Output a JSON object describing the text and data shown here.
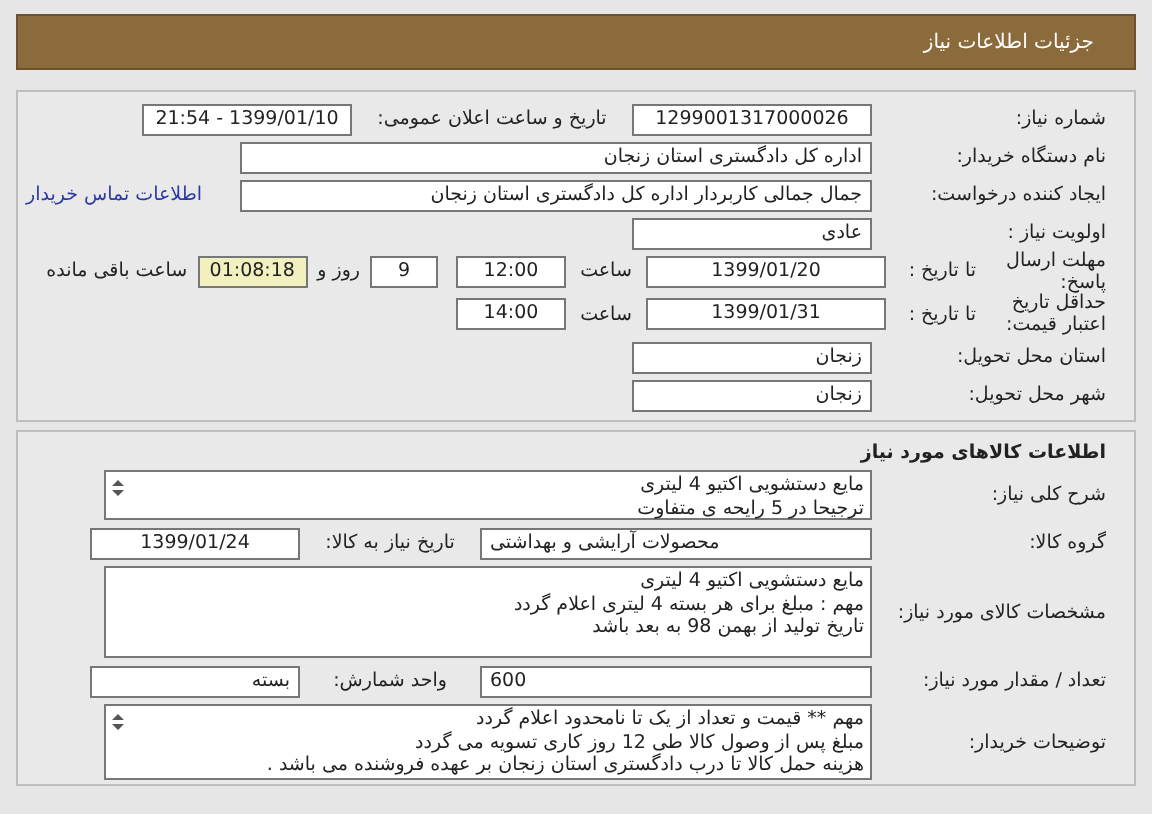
{
  "header": {
    "title": "جزئیات اطلاعات نیاز"
  },
  "details": {
    "need_number": {
      "label": "شماره نیاز:",
      "value": "1299001317000026"
    },
    "announce": {
      "label": "تاریخ و ساعت اعلان عمومی:",
      "value": "1399/01/10 - 21:54"
    },
    "buyer_org": {
      "label": "نام دستگاه خریدار:",
      "value": "اداره کل دادگستری استان زنجان"
    },
    "requester": {
      "label": "ایجاد کننده درخواست:",
      "value": "جمال جمالی کاربردار اداره کل دادگستری استان زنجان",
      "link": "اطلاعات تماس خریدار"
    },
    "priority": {
      "label": "اولویت نیاز :",
      "value": "عادی"
    },
    "deadline": {
      "label": "مهلت ارسال پاسخ:",
      "to_label": "تا تاریخ :",
      "date": "1399/01/20",
      "time_label": "ساعت",
      "time": "12:00",
      "days": "9",
      "days_label": "روز و",
      "remaining": "01:08:18",
      "remaining_label": "ساعت باقی مانده"
    },
    "validity": {
      "label": "حداقل تاریخ اعتبار قیمت:",
      "to_label": "تا تاریخ :",
      "date": "1399/01/31",
      "time_label": "ساعت",
      "time": "14:00"
    },
    "province": {
      "label": "استان محل تحویل:",
      "value": "زنجان"
    },
    "city": {
      "label": "شهر محل تحویل:",
      "value": "زنجان"
    }
  },
  "goods": {
    "title": "اطلاعات کالاهای مورد نیاز",
    "description": {
      "label": "شرح کلی نیاز:",
      "lines": [
        "مایع دستشویی اکتیو 4 لیتری",
        "ترجیحا در 5 رایحه ی متفاوت"
      ]
    },
    "group": {
      "label": "گروه کالا:",
      "value": "محصولات آرایشی و بهداشتی"
    },
    "need_date": {
      "label": "تاریخ نیاز به کالا:",
      "value": "1399/01/24"
    },
    "specs": {
      "label": "مشخصات کالای مورد نیاز:",
      "lines": [
        "مایع دستشویی اکتیو 4 لیتری",
        "مهم : مبلغ برای هر بسته 4 لیتری اعلام گردد",
        "تاریخ تولید از بهمن 98 به بعد باشد"
      ]
    },
    "quantity": {
      "label": "تعداد / مقدار مورد نیاز:",
      "value": "600"
    },
    "unit": {
      "label": "واحد شمارش:",
      "value": "بسته"
    },
    "notes": {
      "label": "توضیحات خریدار:",
      "lines": [
        "مهم ** قیمت و تعداد از یک تا نامحدود اعلام گردد",
        "مبلغ پس از وصول کالا طی 12 روز کاری تسویه می گردد",
        "هزینه حمل کالا تا درب دادگستری استان زنجان بر عهده فروشنده می باشد ."
      ]
    }
  }
}
